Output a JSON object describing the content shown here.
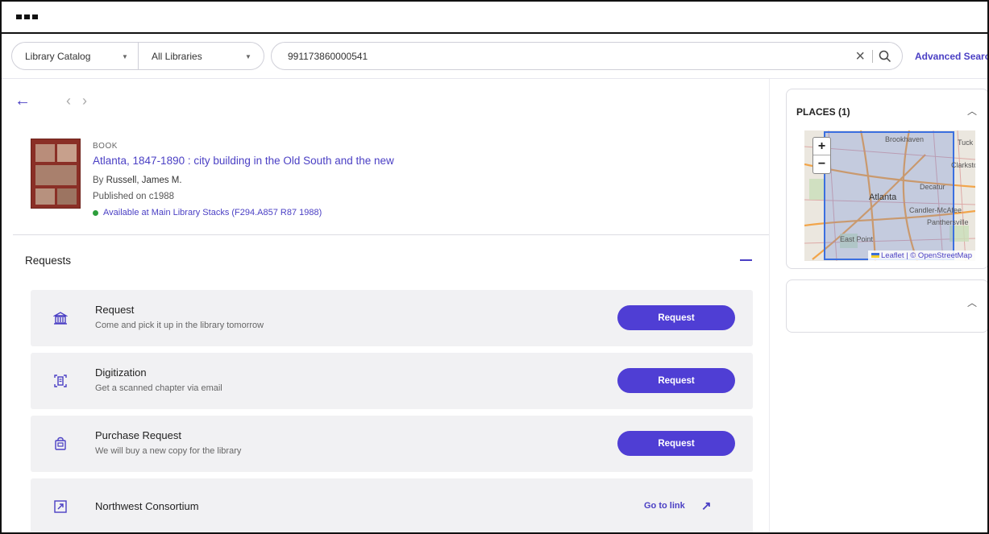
{
  "search": {
    "scope_label": "Library Catalog",
    "library_label": "All Libraries",
    "query_value": "991173860000541",
    "advanced_label": "Advanced Search"
  },
  "record": {
    "type": "BOOK",
    "title": "Atlanta, 1847-1890 : city building in the Old South and the new",
    "author_prefix": "By",
    "author": "Russell, James M.",
    "published_prefix": "Published on",
    "published": "c1988",
    "availability": "Available at Main Library Stacks (F294.A857 R87 1988)",
    "availability_color": "#2c9e3b"
  },
  "requests": {
    "title": "Requests",
    "items": [
      {
        "icon": "library-building-icon",
        "title": "Request",
        "desc": "Come and pick it up in the library tomorrow",
        "action": "Request"
      },
      {
        "icon": "scan-document-icon",
        "title": "Digitization",
        "desc": "Get a scanned chapter via email",
        "action": "Request"
      },
      {
        "icon": "purchase-bag-icon",
        "title": "Purchase Request",
        "desc": "We will buy a new copy for the library",
        "action": "Request"
      },
      {
        "icon": "external-link-icon",
        "title": "Northwest Consortium",
        "desc": "",
        "action": "Go to link"
      }
    ]
  },
  "places": {
    "title": "PLACES (1)",
    "map_labels": [
      "Brookhaven",
      "Tuck",
      "Clarkston",
      "Decatur",
      "Atlanta",
      "Candler-McAfee",
      "Panthersville",
      "East Point"
    ],
    "zoom_in": "+",
    "zoom_out": "−",
    "attribution_leaflet": "Leaflet",
    "attribution_osm": "| © OpenStreetMap"
  },
  "colors": {
    "accent": "#4a3fc4",
    "button": "#4f3ed4",
    "card_bg": "#f1f1f3"
  }
}
